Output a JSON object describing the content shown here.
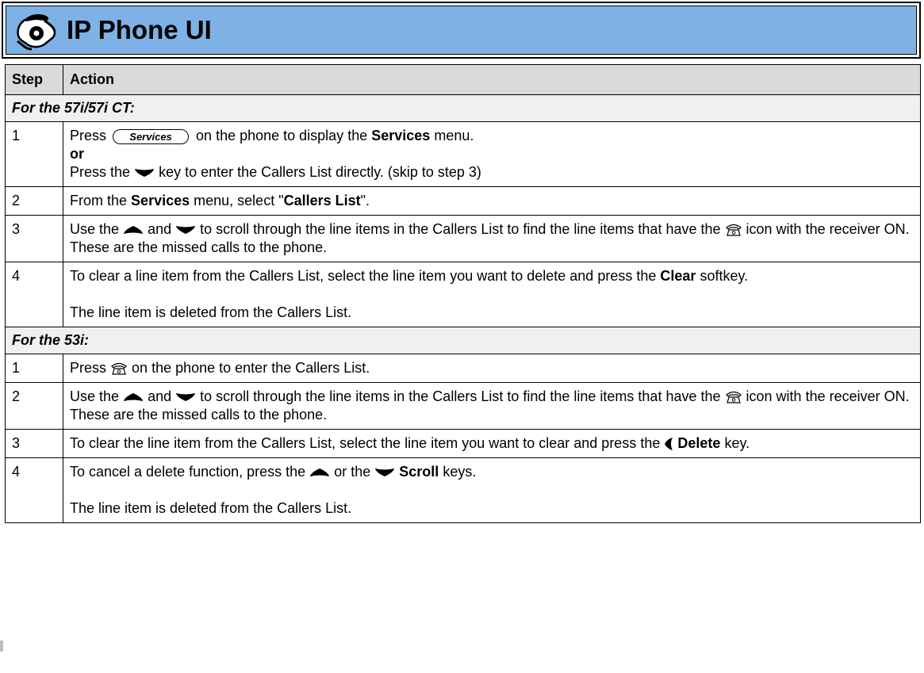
{
  "header": {
    "title": "IP Phone UI",
    "icon": "phone-hand-icon",
    "background_color": "#7eb2e6"
  },
  "table": {
    "col_step": "Step",
    "col_action": "Action",
    "sections": [
      {
        "title": "For the 57i/57i CT:",
        "rows": [
          {
            "step": "1",
            "l1_press": "Press",
            "l1_softkey": "Services",
            "l1_mid": "on the phone to display the",
            "l1_bold": "Services",
            "l1_end": "menu.",
            "or": "or",
            "l3_start": "Press the",
            "l3_end": "key to enter the Callers List directly. (skip to step 3)"
          },
          {
            "step": "2",
            "t1": "From the",
            "b1": "Services",
            "t2": "menu, select \"",
            "b2": "Callers List",
            "t3": "\"."
          },
          {
            "step": "3",
            "t1": "Use the",
            "t2": "and",
            "t3": "to scroll through the line items in the Callers List to find the line items that have the",
            "t4": "icon with the receiver ON. These are the missed calls to the phone."
          },
          {
            "step": "4",
            "t1": "To clear a line item from the Callers List, select the line item you want to delete and press the",
            "b1": "Clear",
            "t2": "softkey.",
            "note": "The line item is deleted from the Callers List."
          }
        ]
      },
      {
        "title": "For the 53i:",
        "rows": [
          {
            "step": "1",
            "t1": "Press",
            "t2": "on the phone to enter the Callers List."
          },
          {
            "step": "2",
            "t1": "Use the",
            "t2": "and",
            "t3": "to scroll through the line items in the Callers List to find the line items that have the",
            "t4": "icon with the receiver ON. These are the missed calls to the phone."
          },
          {
            "step": "3",
            "t1": "To clear the line item from the Callers List, select the line item you want to clear and press the",
            "b1": "Delete",
            "t2": "key."
          },
          {
            "step": "4",
            "t1": "To cancel a delete function, press the",
            "t2": "or the",
            "b1": "Scroll",
            "t3": "keys.",
            "note": "The line item is deleted from the Callers List."
          }
        ]
      }
    ]
  },
  "icons": {
    "up_key": "up-arrow-key-icon",
    "down_key": "down-arrow-key-icon",
    "left_key": "left-arrow-key-icon",
    "callers_list": "callers-list-phone-icon",
    "services_softkey": "services-softkey-icon"
  }
}
